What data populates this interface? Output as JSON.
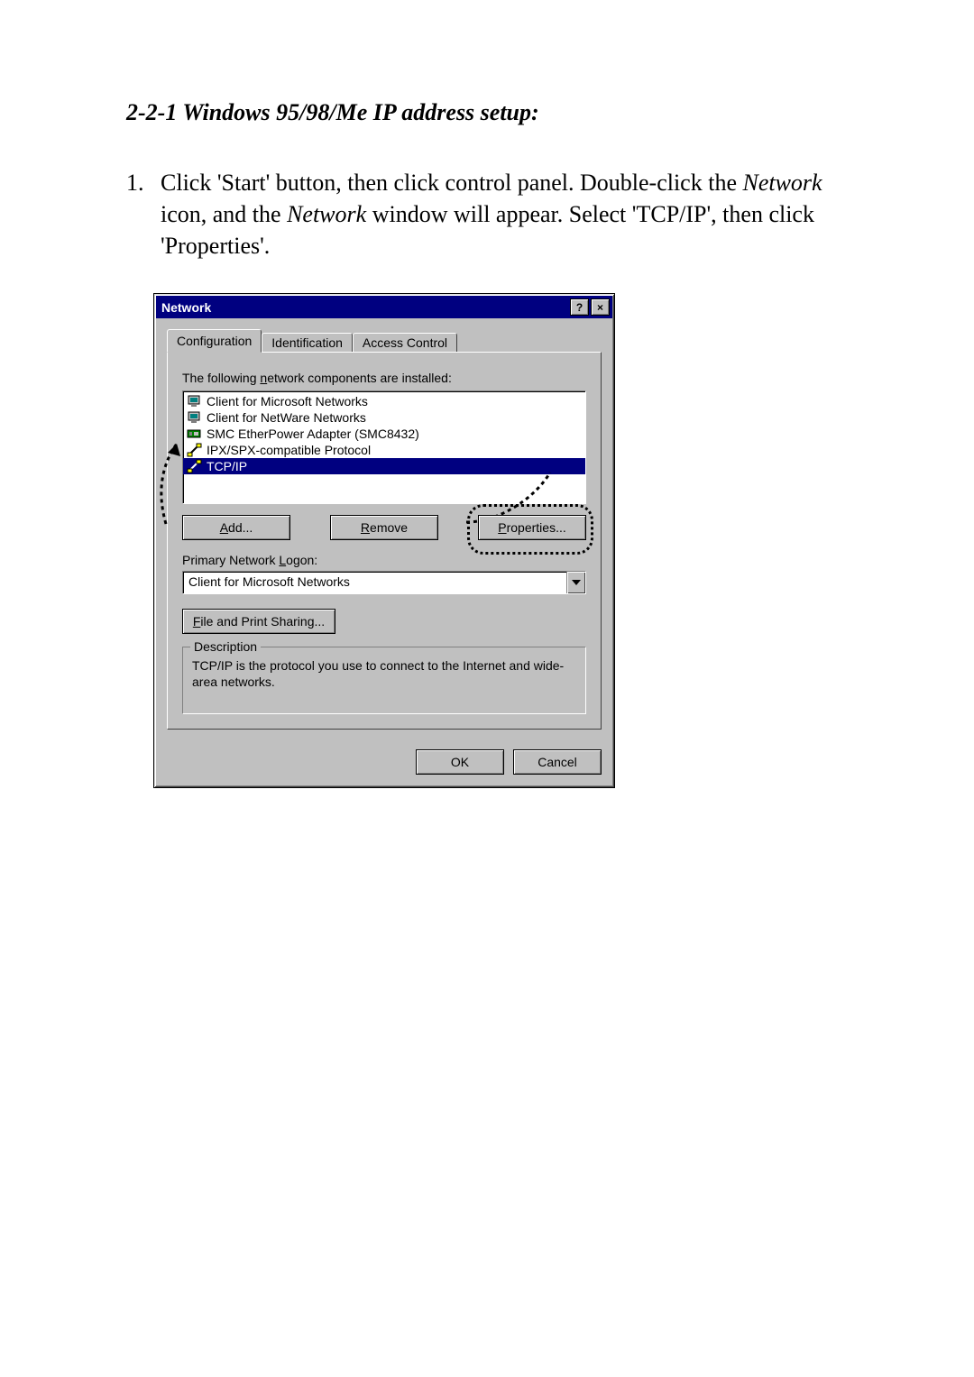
{
  "heading": "2-2-1 Windows 95/98/Me IP address setup:",
  "step": {
    "num": "1.",
    "part1": "Click 'Start' button, then click control panel. Double-click the ",
    "kw1": "Network",
    "part2": " icon, and the ",
    "kw2": "Network",
    "part3": " window will appear. Select 'TCP/IP', then click 'Properties'."
  },
  "dialog": {
    "title": "Network",
    "help_btn": "?",
    "close_btn": "×",
    "tabs": {
      "configuration": "Configuration",
      "identification": "Identification",
      "access_control": "Access Control"
    },
    "list_label_pre": "The following ",
    "list_label_ul": "n",
    "list_label_post": "etwork components are installed:",
    "components": [
      {
        "icon": "client",
        "label": "Client for Microsoft Networks"
      },
      {
        "icon": "client",
        "label": "Client for NetWare Networks"
      },
      {
        "icon": "adapter",
        "label": "SMC EtherPower Adapter (SMC8432)"
      },
      {
        "icon": "protocol",
        "label": "IPX/SPX-compatible Protocol"
      },
      {
        "icon": "protocol",
        "label": "TCP/IP",
        "selected": true
      }
    ],
    "buttons": {
      "add_ul": "A",
      "add_rest": "dd...",
      "remove_ul": "R",
      "remove_rest": "emove",
      "properties_ul": "P",
      "properties_rest": "roperties..."
    },
    "logon_label_pre": "Primary Network ",
    "logon_label_ul": "L",
    "logon_label_post": "ogon:",
    "logon_value": "Client for Microsoft Networks",
    "share_ul": "F",
    "share_rest": "ile and Print Sharing...",
    "description_legend": "Description",
    "description_body": "TCP/IP is the protocol you use to connect to the Internet and wide-area networks.",
    "ok": "OK",
    "cancel": "Cancel"
  }
}
